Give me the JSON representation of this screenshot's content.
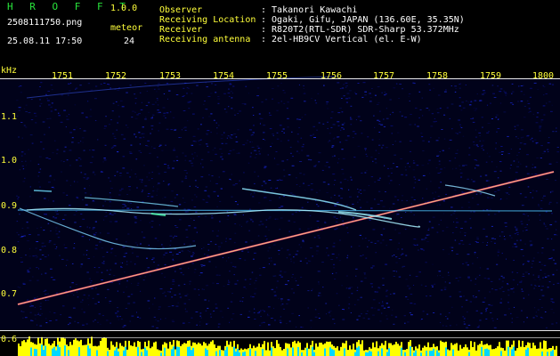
{
  "app": {
    "logo_letters": "H R O F F T",
    "version": "1.0.0",
    "filename": "2508111750.png",
    "datetime": "25.08.11 17:50",
    "meteor_label": "meteor",
    "meteor_count": "24"
  },
  "observation": {
    "rows": [
      {
        "label": "Observer",
        "value": ": Takanori Kawachi"
      },
      {
        "label": "Receiving Location",
        "value": ": Ogaki, Gifu, JAPAN (136.60E, 35.35N)"
      },
      {
        "label": "Receiver",
        "value": ": R820T2(RTL-SDR) SDR-Sharp 53.372MHz"
      },
      {
        "label": "Receiving antenna",
        "value": ": 2el-HB9CV Vertical (el. E-W)"
      }
    ]
  },
  "axis": {
    "y_unit": "kHz",
    "y_ticks": [
      "1.1",
      "1.0",
      "0.9",
      "0.8",
      "0.7",
      "0.6"
    ],
    "x_ticks": [
      "1751",
      "1752",
      "1753",
      "1754",
      "1755",
      "1756",
      "1757",
      "1758",
      "1759",
      "1800"
    ]
  },
  "colors": {
    "label": "#ffff3a",
    "logo": "#29e53c",
    "background": "#000000",
    "noise": "#0a0f7a",
    "trace": "#9fe8ff",
    "level": "#ffff00",
    "level_base": "#00d8ff"
  }
}
